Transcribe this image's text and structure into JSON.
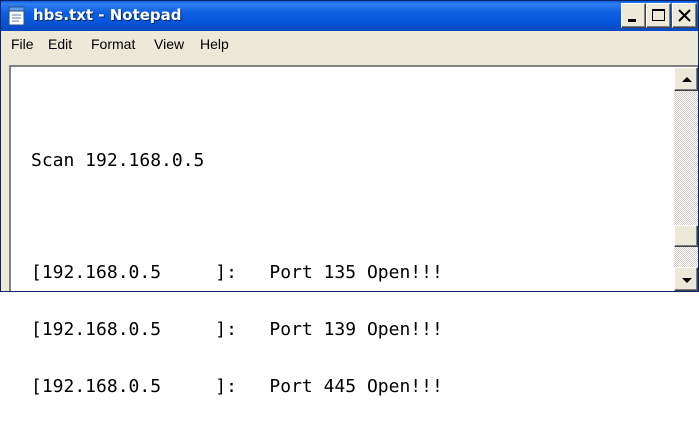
{
  "window": {
    "title": "hbs.txt - Notepad",
    "app_icon": "notepad-icon",
    "caption_buttons": [
      "minimize-icon",
      "maximize-icon",
      "close-icon"
    ]
  },
  "menu": {
    "items": [
      "File",
      "Edit",
      "Format",
      "View",
      "Help"
    ]
  },
  "document": {
    "lines": [
      "",
      "Scan 192.168.0.5",
      "",
      "[192.168.0.5     ]:   Port 135 Open!!!",
      "[192.168.0.5     ]:   Port 139 Open!!!",
      "[192.168.0.5     ]:   Port 445 Open!!!"
    ]
  },
  "scrollbar": {
    "up_icon": "arrow-up-icon",
    "down_icon": "arrow-down-icon"
  },
  "colors": {
    "titlebar": "#0a58d6",
    "chrome": "#ece9d8",
    "editor_bg": "#ffffff"
  }
}
